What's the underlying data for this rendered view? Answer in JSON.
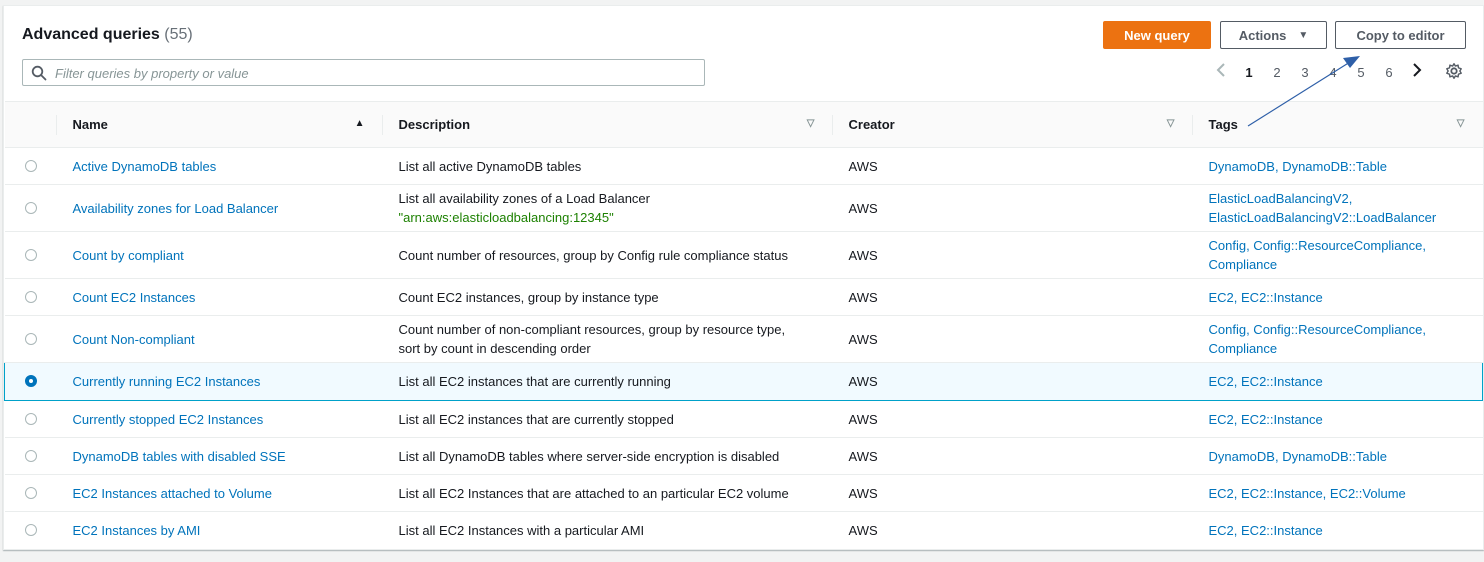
{
  "header": {
    "title": "Advanced queries",
    "count": "(55)",
    "new_query_label": "New query",
    "actions_label": "Actions",
    "copy_label": "Copy to editor"
  },
  "search": {
    "placeholder": "Filter queries by property or value",
    "value": ""
  },
  "pagination": {
    "prev_icon": "chevron-left-icon",
    "pages": [
      "1",
      "2",
      "3",
      "4",
      "5",
      "6"
    ],
    "current": "1",
    "next_icon": "chevron-right-icon",
    "settings_icon": "gear-icon"
  },
  "table": {
    "columns": [
      {
        "label": "Name",
        "sort": "ascending"
      },
      {
        "label": "Description",
        "sort": "none"
      },
      {
        "label": "Creator",
        "sort": "none"
      },
      {
        "label": "Tags",
        "sort": "none"
      }
    ],
    "rows": [
      {
        "name": "Active DynamoDB tables",
        "desc": "List all active DynamoDB tables",
        "desc2": "",
        "creator": "AWS",
        "tags": "DynamoDB, DynamoDB::Table",
        "tags2": "",
        "selected": false
      },
      {
        "name": "Availability zones for Load Balancer",
        "desc": "List all availability zones of a Load Balancer",
        "desc2": "\"arn:aws:elasticloadbalancing:12345\"",
        "creator": "AWS",
        "tags": "ElasticLoadBalancingV2,",
        "tags2": "ElasticLoadBalancingV2::LoadBalancer",
        "selected": false
      },
      {
        "name": "Count by compliant",
        "desc": "Count number of resources, group by Config rule compliance status",
        "desc2": "",
        "creator": "AWS",
        "tags": "Config, Config::ResourceCompliance,",
        "tags2": "Compliance",
        "selected": false
      },
      {
        "name": "Count EC2 Instances",
        "desc": "Count EC2 instances, group by instance type",
        "desc2": "",
        "creator": "AWS",
        "tags": "EC2, EC2::Instance",
        "tags2": "",
        "selected": false
      },
      {
        "name": "Count Non-compliant",
        "desc": "Count number of non-compliant resources, group by resource type,",
        "desc2": "sort by count in descending order",
        "creator": "AWS",
        "tags": "Config, Config::ResourceCompliance,",
        "tags2": "Compliance",
        "selected": false
      },
      {
        "name": "Currently running EC2 Instances",
        "desc": "List all EC2 instances that are currently running",
        "desc2": "",
        "creator": "AWS",
        "tags": "EC2, EC2::Instance",
        "tags2": "",
        "selected": true
      },
      {
        "name": "Currently stopped EC2 Instances",
        "desc": "List all EC2 instances that are currently stopped",
        "desc2": "",
        "creator": "AWS",
        "tags": "EC2, EC2::Instance",
        "tags2": "",
        "selected": false
      },
      {
        "name": "DynamoDB tables with disabled SSE",
        "desc": "List all DynamoDB tables where server-side encryption is disabled",
        "desc2": "",
        "creator": "AWS",
        "tags": "DynamoDB, DynamoDB::Table",
        "tags2": "",
        "selected": false
      },
      {
        "name": "EC2 Instances attached to Volume",
        "desc": "List all EC2 Instances that are attached to an particular EC2 volume",
        "desc2": "",
        "creator": "AWS",
        "tags": "EC2, EC2::Instance, EC2::Volume",
        "tags2": "",
        "selected": false
      },
      {
        "name": "EC2 Instances by AMI",
        "desc": "List all EC2 Instances with a particular AMI",
        "desc2": "",
        "creator": "AWS",
        "tags": "EC2, EC2::Instance",
        "tags2": "",
        "selected": false
      }
    ]
  },
  "colors": {
    "primary": "#ec7211",
    "link": "#0073bb",
    "string": "#1d8102",
    "selected_border": "#00a1c9",
    "annotation_arrow": "#2e5fa8"
  }
}
